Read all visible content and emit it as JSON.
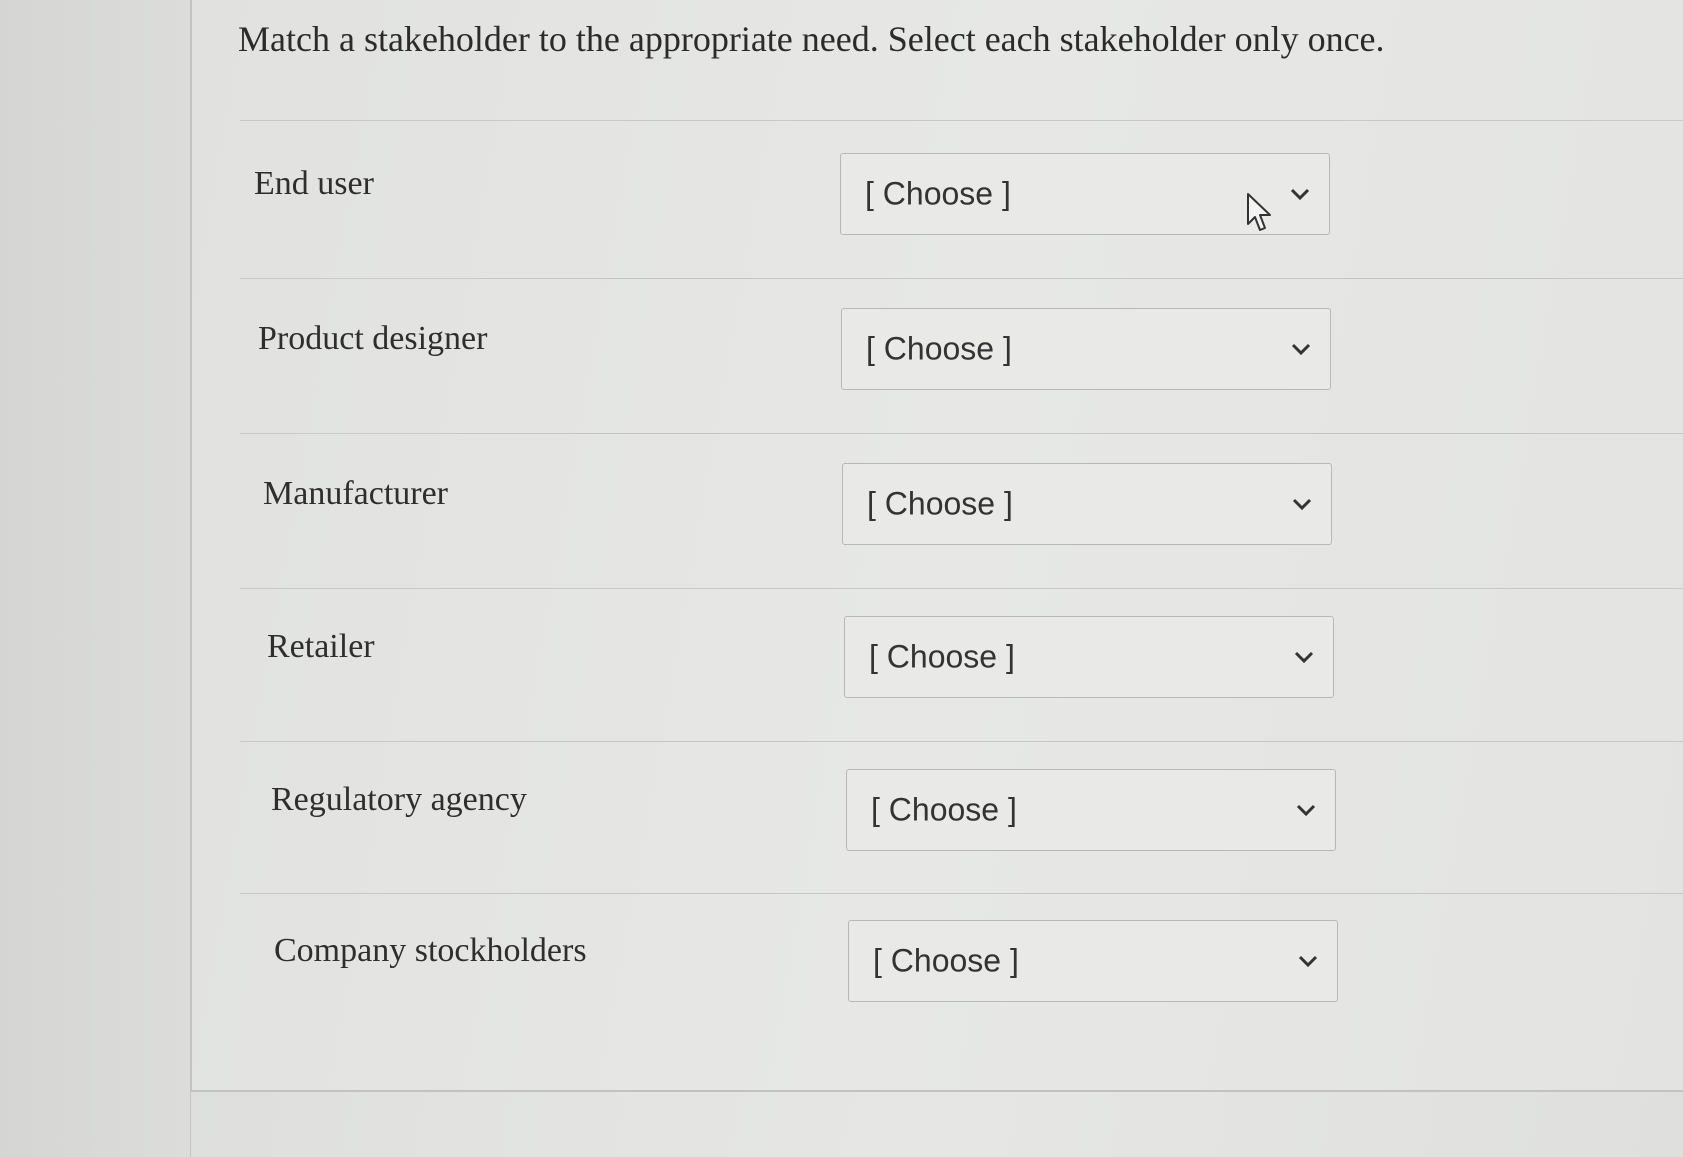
{
  "question": "Match a stakeholder to the appropriate need. Select each stakeholder only once.",
  "rows": [
    {
      "label": "End user",
      "value": "[ Choose ]"
    },
    {
      "label": "Product designer",
      "value": "[ Choose ]"
    },
    {
      "label": "Manufacturer",
      "value": "[ Choose ]"
    },
    {
      "label": "Retailer",
      "value": "[ Choose ]"
    },
    {
      "label": "Regulatory agency",
      "value": "[ Choose ]"
    },
    {
      "label": "Company stockholders",
      "value": "[ Choose ]"
    }
  ],
  "icons": {
    "dropdown": "chevron-down-icon",
    "pointer": "mouse-pointer-icon"
  }
}
